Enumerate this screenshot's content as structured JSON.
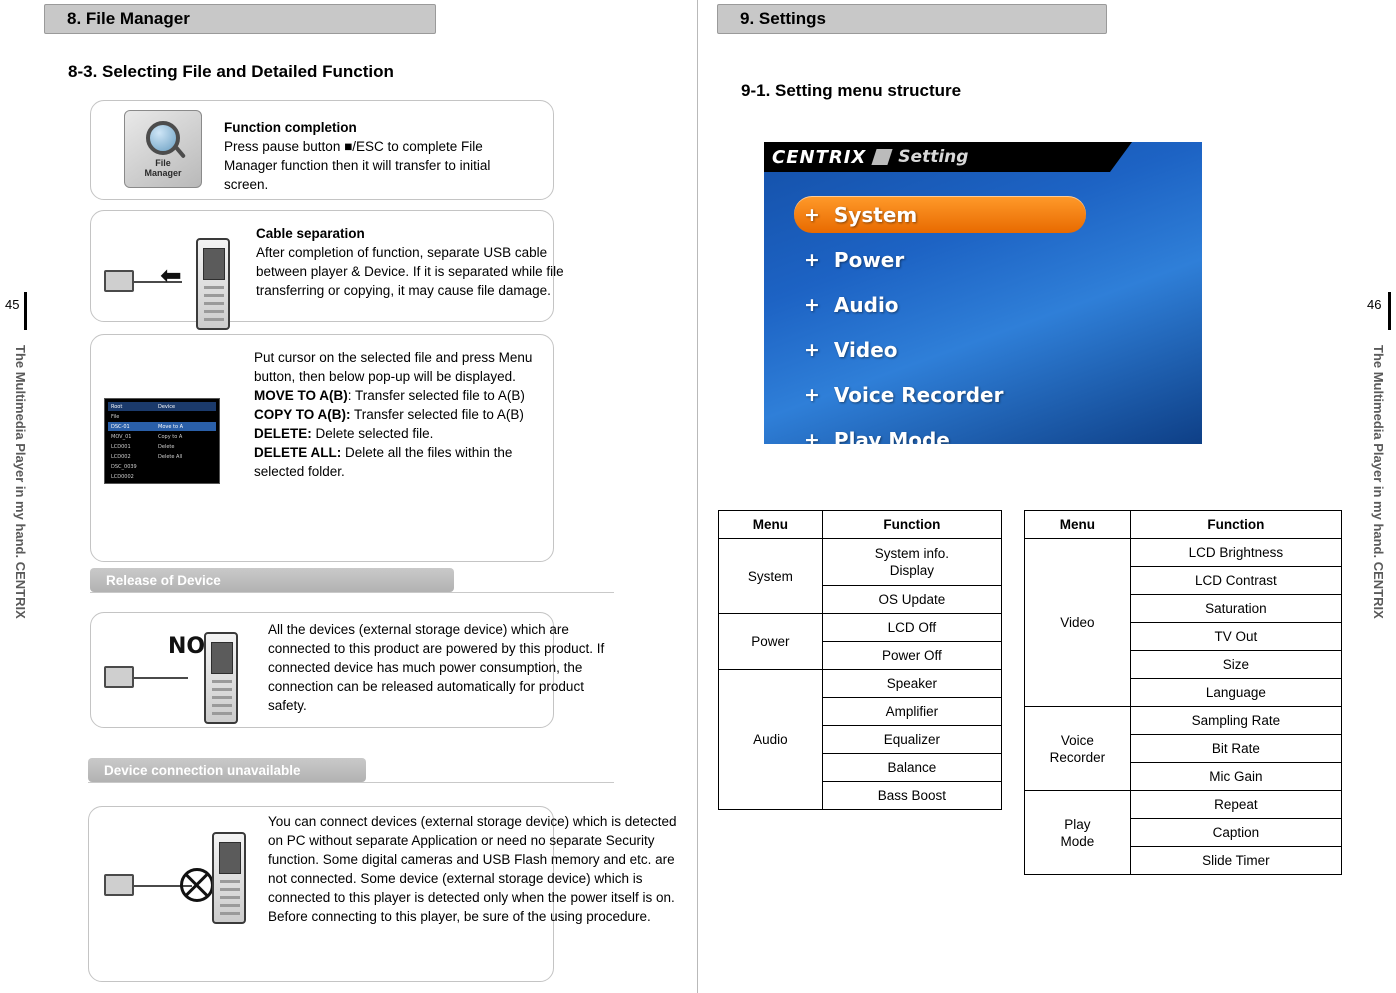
{
  "left_page": {
    "section_tab": "8. File Manager",
    "subsection_title": "8-3. Selecting File and Detailed Function",
    "page_number": "45",
    "side_brand": "The Multimedia Player in my hand.  CENTRIX",
    "boxes": [
      {
        "icon_caption_line1": "File",
        "icon_caption_line2": "Manager",
        "heading": "Function completion",
        "body": "Press pause button ■/ESC to complete File Manager function then it will transfer to initial screen."
      },
      {
        "heading": "Cable separation",
        "body": "After completion of function, separate USB cable between player & Device. If it is separated while file transferring or copying, it may cause file damage."
      },
      {
        "line1": "Put cursor on the selected file and press Menu button, then below pop-up will be displayed.",
        "bold1": "MOVE TO A(B)",
        "rest1": ": Transfer selected file  to A(B)",
        "bold2": "COPY TO A(B):",
        "rest2": " Transfer selected file to A(B)",
        "bold3": "DELETE:",
        "rest3": " Delete selected file.",
        "bold4": "DELETE ALL:",
        "rest4": " Delete all the files within the selected folder."
      },
      {
        "body": "All the devices (external storage device) which are connected to this product are powered by this product. If connected device has much power consumption, the connection can be released automatically for product safety."
      },
      {
        "body": "You can connect devices (external storage device) which is detected on PC without separate Application or need no separate Security function. Some digital cameras and USB Flash memory and etc. are not connected. Some device (external storage device) which is connected to this player is detected only when the power itself is on. Before connecting to this player, be sure of the using procedure."
      }
    ],
    "banners": [
      "Release of Device",
      "Device connection unavailable"
    ],
    "menu_shot_rows": [
      {
        "c1": "Root",
        "c2": "Device"
      },
      {
        "c1": "File",
        "c2": ""
      },
      {
        "c1": "DSC-01",
        "c2": "Move to A"
      },
      {
        "c1": "MOV_01",
        "c2": "Copy to A"
      },
      {
        "c1": "LCD001",
        "c2": "Delete"
      },
      {
        "c1": "LCD002",
        "c2": "Delete All"
      },
      {
        "c1": "DSC_0039",
        "c2": ""
      },
      {
        "c1": "LCD0002",
        "c2": ""
      }
    ]
  },
  "right_page": {
    "section_tab": "9. Settings",
    "subsection_title": "9-1. Setting menu structure",
    "page_number": "46",
    "side_brand": "The Multimedia Player in my hand.  CENTRIX",
    "screen": {
      "brand": "CENTRIX",
      "title": "Setting",
      "items": [
        {
          "label": "System",
          "selected": true
        },
        {
          "label": "Power",
          "selected": false
        },
        {
          "label": "Audio",
          "selected": false
        },
        {
          "label": "Video",
          "selected": false
        },
        {
          "label": "Voice Recorder",
          "selected": false
        },
        {
          "label": "Play Mode",
          "selected": false
        }
      ],
      "plus_glyph": "+"
    },
    "table_left": {
      "headers": [
        "Menu",
        "Function"
      ],
      "groups": [
        {
          "menu": "System",
          "functions": [
            "System info.\nDisplay",
            "OS Update"
          ]
        },
        {
          "menu": "Power",
          "functions": [
            "LCD Off",
            "Power Off"
          ]
        },
        {
          "menu": "Audio",
          "functions": [
            "Speaker",
            "Amplifier",
            "Equalizer",
            "Balance",
            "Bass Boost"
          ]
        }
      ]
    },
    "table_right": {
      "headers": [
        "Menu",
        "Function"
      ],
      "groups": [
        {
          "menu": "Video",
          "functions": [
            "LCD Brightness",
            "LCD Contrast",
            "Saturation",
            "TV Out",
            "Size",
            "Language"
          ]
        },
        {
          "menu": "Voice\nRecorder",
          "functions": [
            "Sampling Rate",
            "Bit Rate",
            "Mic Gain"
          ]
        },
        {
          "menu": "Play\nMode",
          "functions": [
            "Repeat",
            "Caption",
            "Slide Timer"
          ]
        }
      ]
    }
  }
}
